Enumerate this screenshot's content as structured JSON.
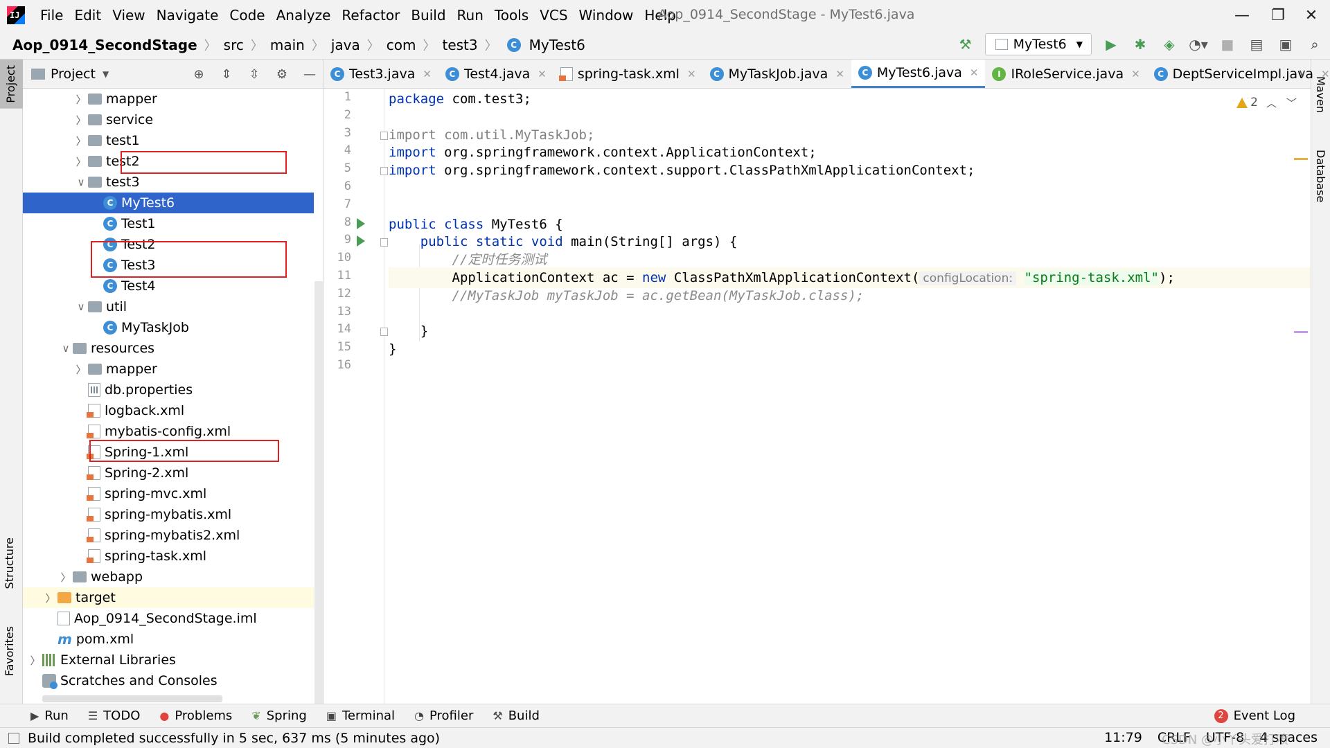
{
  "menu": {
    "logo_text": "IJ",
    "items": [
      "File",
      "Edit",
      "View",
      "Navigate",
      "Code",
      "Analyze",
      "Refactor",
      "Build",
      "Run",
      "Tools",
      "VCS",
      "Window",
      "Help"
    ],
    "window_title": "Aop_0914_SecondStage - MyTest6.java"
  },
  "breadcrumb": {
    "project": "Aop_0914_SecondStage",
    "parts": [
      "src",
      "main",
      "java",
      "com",
      "test3"
    ],
    "current": "MyTest6"
  },
  "toolbar": {
    "run_config": "MyTest6",
    "icons": [
      "hammer-icon",
      "run-icon",
      "debug-icon",
      "coverage-icon",
      "profile-icon",
      "stop-icon",
      "project-structure-icon",
      "layout-icon",
      "search-icon"
    ]
  },
  "side_tabs": {
    "left": [
      "Project",
      "Structure",
      "Favorites"
    ],
    "right": [
      "Maven",
      "Database"
    ]
  },
  "project_panel": {
    "title": "Project",
    "tree": [
      {
        "label": "mapper",
        "type": "folder",
        "indent": 2,
        "chevron": "right"
      },
      {
        "label": "service",
        "type": "folder",
        "indent": 2,
        "chevron": "right"
      },
      {
        "label": "test1",
        "type": "folder",
        "indent": 2,
        "chevron": "right"
      },
      {
        "label": "test2",
        "type": "folder",
        "indent": 2,
        "chevron": "right"
      },
      {
        "label": "test3",
        "type": "folder",
        "indent": 2,
        "chevron": "down"
      },
      {
        "label": "MyTest6",
        "type": "class-run",
        "indent": 3,
        "chevron": "",
        "selected": true
      },
      {
        "label": "Test1",
        "type": "class-run",
        "indent": 3,
        "chevron": ""
      },
      {
        "label": "Test2",
        "type": "class-run",
        "indent": 3,
        "chevron": ""
      },
      {
        "label": "Test3",
        "type": "class-run",
        "indent": 3,
        "chevron": ""
      },
      {
        "label": "Test4",
        "type": "class-run",
        "indent": 3,
        "chevron": ""
      },
      {
        "label": "util",
        "type": "folder",
        "indent": 2,
        "chevron": "down"
      },
      {
        "label": "MyTaskJob",
        "type": "class",
        "indent": 3,
        "chevron": ""
      },
      {
        "label": "resources",
        "type": "res-folder",
        "indent": 1,
        "chevron": "down"
      },
      {
        "label": "mapper",
        "type": "folder",
        "indent": 2,
        "chevron": "right"
      },
      {
        "label": "db.properties",
        "type": "props",
        "indent": 2,
        "chevron": ""
      },
      {
        "label": "logback.xml",
        "type": "xml",
        "indent": 2,
        "chevron": ""
      },
      {
        "label": "mybatis-config.xml",
        "type": "xml",
        "indent": 2,
        "chevron": ""
      },
      {
        "label": "Spring-1.xml",
        "type": "xml",
        "indent": 2,
        "chevron": ""
      },
      {
        "label": "Spring-2.xml",
        "type": "xml",
        "indent": 2,
        "chevron": ""
      },
      {
        "label": "spring-mvc.xml",
        "type": "xml",
        "indent": 2,
        "chevron": ""
      },
      {
        "label": "spring-mybatis.xml",
        "type": "xml",
        "indent": 2,
        "chevron": ""
      },
      {
        "label": "spring-mybatis2.xml",
        "type": "xml",
        "indent": 2,
        "chevron": ""
      },
      {
        "label": "spring-task.xml",
        "type": "xml",
        "indent": 2,
        "chevron": ""
      },
      {
        "label": "webapp",
        "type": "folder",
        "indent": 1,
        "chevron": "right"
      },
      {
        "label": "target",
        "type": "orange-folder",
        "indent": 0,
        "chevron": "right",
        "highlight": true
      },
      {
        "label": "Aop_0914_SecondStage.iml",
        "type": "file",
        "indent": 0,
        "chevron": ""
      },
      {
        "label": "pom.xml",
        "type": "maven",
        "indent": 0,
        "chevron": ""
      },
      {
        "label": "External Libraries",
        "type": "lib",
        "indent": -1,
        "chevron": "right"
      },
      {
        "label": "Scratches and Consoles",
        "type": "scratch",
        "indent": -1,
        "chevron": ""
      }
    ]
  },
  "editor": {
    "tabs": [
      {
        "label": "Test3.java",
        "icon": "class-run"
      },
      {
        "label": "Test4.java",
        "icon": "class-run"
      },
      {
        "label": "spring-task.xml",
        "icon": "xml"
      },
      {
        "label": "MyTaskJob.java",
        "icon": "class"
      },
      {
        "label": "MyTest6.java",
        "icon": "class-run",
        "active": true
      },
      {
        "label": "IRoleService.java",
        "icon": "interface"
      },
      {
        "label": "DeptServiceImpl.java",
        "icon": "class"
      }
    ],
    "warning_count": "2",
    "line_numbers": [
      "1",
      "2",
      "3",
      "4",
      "5",
      "6",
      "7",
      "8",
      "9",
      "10",
      "11",
      "12",
      "13",
      "14",
      "15",
      "16"
    ],
    "lines": [
      {
        "tokens": [
          {
            "t": "package ",
            "c": "kw"
          },
          {
            "t": "com.test3;",
            "c": ""
          }
        ]
      },
      {
        "tokens": []
      },
      {
        "tokens": [
          {
            "t": "import com.util.MyTaskJob;",
            "c": "unused"
          }
        ]
      },
      {
        "tokens": [
          {
            "t": "import ",
            "c": "kw"
          },
          {
            "t": "org.springframework.context.ApplicationContext;",
            "c": ""
          }
        ]
      },
      {
        "tokens": [
          {
            "t": "import ",
            "c": "kw"
          },
          {
            "t": "org.springframework.context.support.ClassPathXmlApplicationContext;",
            "c": ""
          }
        ]
      },
      {
        "tokens": []
      },
      {
        "tokens": []
      },
      {
        "tokens": [
          {
            "t": "public class ",
            "c": "kw"
          },
          {
            "t": "MyTest6 {",
            "c": ""
          }
        ]
      },
      {
        "tokens": [
          {
            "t": "    public static void ",
            "c": "kw"
          },
          {
            "t": "main(String[] args) {",
            "c": ""
          }
        ]
      },
      {
        "tokens": [
          {
            "t": "        //定时任务测试",
            "c": "cmt"
          }
        ]
      },
      {
        "tokens": [
          {
            "t": "        ApplicationContext ac = ",
            "c": ""
          },
          {
            "t": "new ",
            "c": "kw"
          },
          {
            "t": "ClassPathXmlApplicationContext(",
            "c": ""
          },
          {
            "t": "configLocation:",
            "c": "param"
          },
          {
            "t": " ",
            "c": ""
          },
          {
            "t": "\"spring-task.xml\"",
            "c": "str"
          },
          {
            "t": ");",
            "c": ""
          }
        ],
        "current": true
      },
      {
        "tokens": [
          {
            "t": "        //MyTaskJob myTaskJob = ac.getBean(MyTaskJob.class);",
            "c": "cmt"
          }
        ]
      },
      {
        "tokens": []
      },
      {
        "tokens": [
          {
            "t": "    }",
            "c": ""
          }
        ]
      },
      {
        "tokens": [
          {
            "t": "}",
            "c": ""
          }
        ]
      },
      {
        "tokens": []
      }
    ]
  },
  "tool_windows": {
    "items": [
      {
        "label": "Run",
        "icon": "run-icon"
      },
      {
        "label": "TODO",
        "icon": "todo-icon"
      },
      {
        "label": "Problems",
        "icon": "problems-icon"
      },
      {
        "label": "Spring",
        "icon": "spring-icon"
      },
      {
        "label": "Terminal",
        "icon": "terminal-icon"
      },
      {
        "label": "Profiler",
        "icon": "profiler-icon"
      },
      {
        "label": "Build",
        "icon": "build-icon"
      }
    ],
    "event_log": "Event Log",
    "event_count": "2"
  },
  "status": {
    "message": "Build completed successfully in 5 sec, 637 ms (5 minutes ago)",
    "position": "11:79",
    "line_sep": "CRLF",
    "encoding": "UTF-8",
    "indent": "4 spaces",
    "watermark": "CSDN @小丫头爱打喷"
  },
  "colors": {
    "selection": "#2f65ca",
    "highlight_box": "#e02020",
    "keyword": "#0033b3",
    "string": "#067d17",
    "comment": "#8c8c8c"
  }
}
